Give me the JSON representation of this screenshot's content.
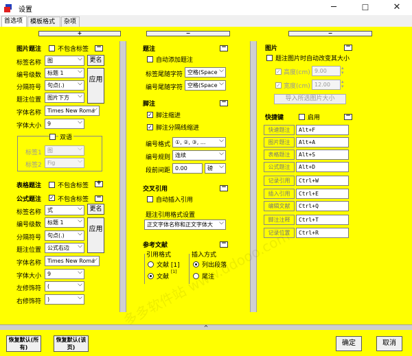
{
  "window": {
    "title": "设置",
    "min": "─",
    "max": "☐",
    "close": "✕"
  },
  "tabs": [
    "首选项",
    "模板格式",
    "杂项"
  ],
  "col_buttons": {
    "left": "+",
    "middle": "−",
    "right": "−"
  },
  "fig": {
    "heading": "图片题注",
    "no_label": "不包含标签",
    "label_name": "标签名称",
    "label_value": "图",
    "rename": "更名",
    "level": "编号级数",
    "level_value": "标题 1",
    "sep": "分隔符号",
    "sep_value": "句点(.)",
    "pos": "题注位置",
    "pos_value": "图片下方",
    "apply": "应用",
    "font": "字体名称",
    "font_value": "Times New Roma",
    "size": "字体大小",
    "size_value": "9",
    "bilingual": "双语",
    "label1": "标签1",
    "label1_value": "图",
    "label2": "标签2",
    "label2_value": "Fig"
  },
  "tbl": {
    "heading": "表格题注",
    "no_label": "不包含标签"
  },
  "formula": {
    "heading": "公式题注",
    "no_label": "不包含标签",
    "label_name": "标签名称",
    "label_value": "式",
    "rename": "更名",
    "level": "编号级数",
    "level_value": "标题 1",
    "sep": "分隔符号",
    "sep_value": "句点(.)",
    "pos": "题注位置",
    "pos_value": "公式右边",
    "apply": "应用",
    "font": "字体名称",
    "font_value": "Times New Roma",
    "size": "字体大小",
    "size_value": "9",
    "left_deco": "左修饰符",
    "left_deco_value": "(",
    "right_deco": "右修饰符",
    "right_deco_value": ")"
  },
  "caption": {
    "heading": "题注",
    "auto_add": "自动添加题注",
    "tail_label": "标签尾随字符",
    "tail_label_value": "空格(Space",
    "tail_num": "编号尾随字符",
    "tail_num_value": "空格(Space"
  },
  "footnote": {
    "heading": "脚注",
    "indent": "脚注缩进",
    "sep_indent": "脚注分隔线缩进",
    "fmt": "编号格式",
    "fmt_value": "①, ②, ③, ...",
    "rule": "编号规则",
    "rule_value": "连续",
    "spacing": "段前间距",
    "spacing_value": "0.00",
    "unit_value": "磅"
  },
  "crossref": {
    "heading": "交叉引用",
    "auto_insert": "自动插入引用",
    "fmt_heading": "题注引用格式设置",
    "fmt_value": "正文字体名称和正文字体大"
  },
  "refs": {
    "heading": "参考文献",
    "cite_fmt": "引用格式",
    "opt1": "文献 [1]",
    "opt2": "文献",
    "opt2_sup": "[1]",
    "insert": "插入方式",
    "ins1": "列出段落",
    "ins2": "尾注"
  },
  "picture": {
    "heading": "图片",
    "auto_resize": "题注图片时自动改变其大小",
    "height": "高度(cm)",
    "height_value": "9.00",
    "width": "宽度(cm)",
    "width_value": "12.00",
    "import_btn": "导入所选图片大小"
  },
  "hotkeys": {
    "heading": "快捷键",
    "enable": "启用",
    "items": [
      {
        "name": "快速题注",
        "key": "Alt+F"
      },
      {
        "name": "图片题注",
        "key": "Alt+A"
      },
      {
        "name": "表格题注",
        "key": "Alt+S"
      },
      {
        "name": "公式题注",
        "key": "Alt+D"
      },
      {
        "name": "记录引用",
        "key": "Ctrl+W"
      },
      {
        "name": "插入引用",
        "key": "Ctrl+E"
      },
      {
        "name": "编辑文献",
        "key": "Ctrl+Q"
      },
      {
        "name": "脚注注释",
        "key": "Ctrl+T"
      },
      {
        "name": "记录位置",
        "key": "Ctrl+R"
      }
    ]
  },
  "footer": {
    "restore_all": "恢复默认(所有)",
    "restore_page": "恢复默认(该页)",
    "ok": "确定",
    "cancel": "取消",
    "collapse": "^"
  },
  "watermark": "多多软件站 www.ddooo.com",
  "colors": {
    "panel": "#ffff00",
    "app_icon_red": "#e02020",
    "app_icon_blue": "#2040c0"
  }
}
